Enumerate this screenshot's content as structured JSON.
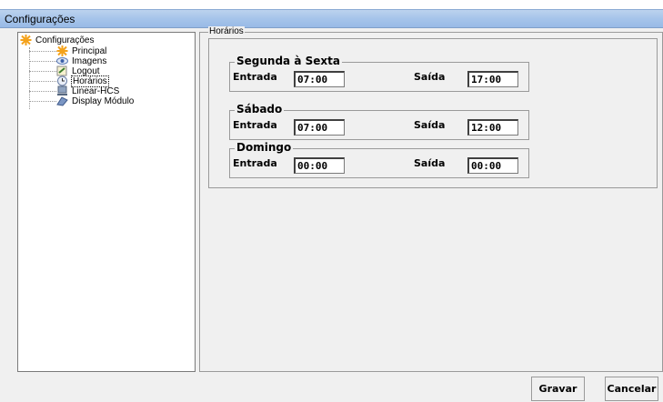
{
  "window": {
    "title": "Configurações"
  },
  "tree": {
    "root": "Configurações",
    "items": [
      {
        "label": "Principal",
        "icon": "gear-star-icon"
      },
      {
        "label": "Imagens",
        "icon": "eye-icon"
      },
      {
        "label": "Logout",
        "icon": "logout-icon"
      },
      {
        "label": "Horários",
        "icon": "clock-icon",
        "selected": true
      },
      {
        "label": "Linear-HCS",
        "icon": "device-icon"
      },
      {
        "label": "Display Módulo",
        "icon": "display-icon"
      }
    ]
  },
  "panel": {
    "title": "Horários",
    "groups": [
      {
        "name": "Segunda à Sexta",
        "entrada_label": "Entrada",
        "entrada": "07:00",
        "saida_label": "Saída",
        "saida": "17:00"
      },
      {
        "name": "Sábado",
        "entrada_label": "Entrada",
        "entrada": "07:00",
        "saida_label": "Saída",
        "saida": "12:00"
      },
      {
        "name": "Domingo",
        "entrada_label": "Entrada",
        "entrada": "00:00",
        "saida_label": "Saída",
        "saida": "00:00"
      }
    ]
  },
  "buttons": {
    "save": "Gravar",
    "cancel": "Cancelar"
  }
}
